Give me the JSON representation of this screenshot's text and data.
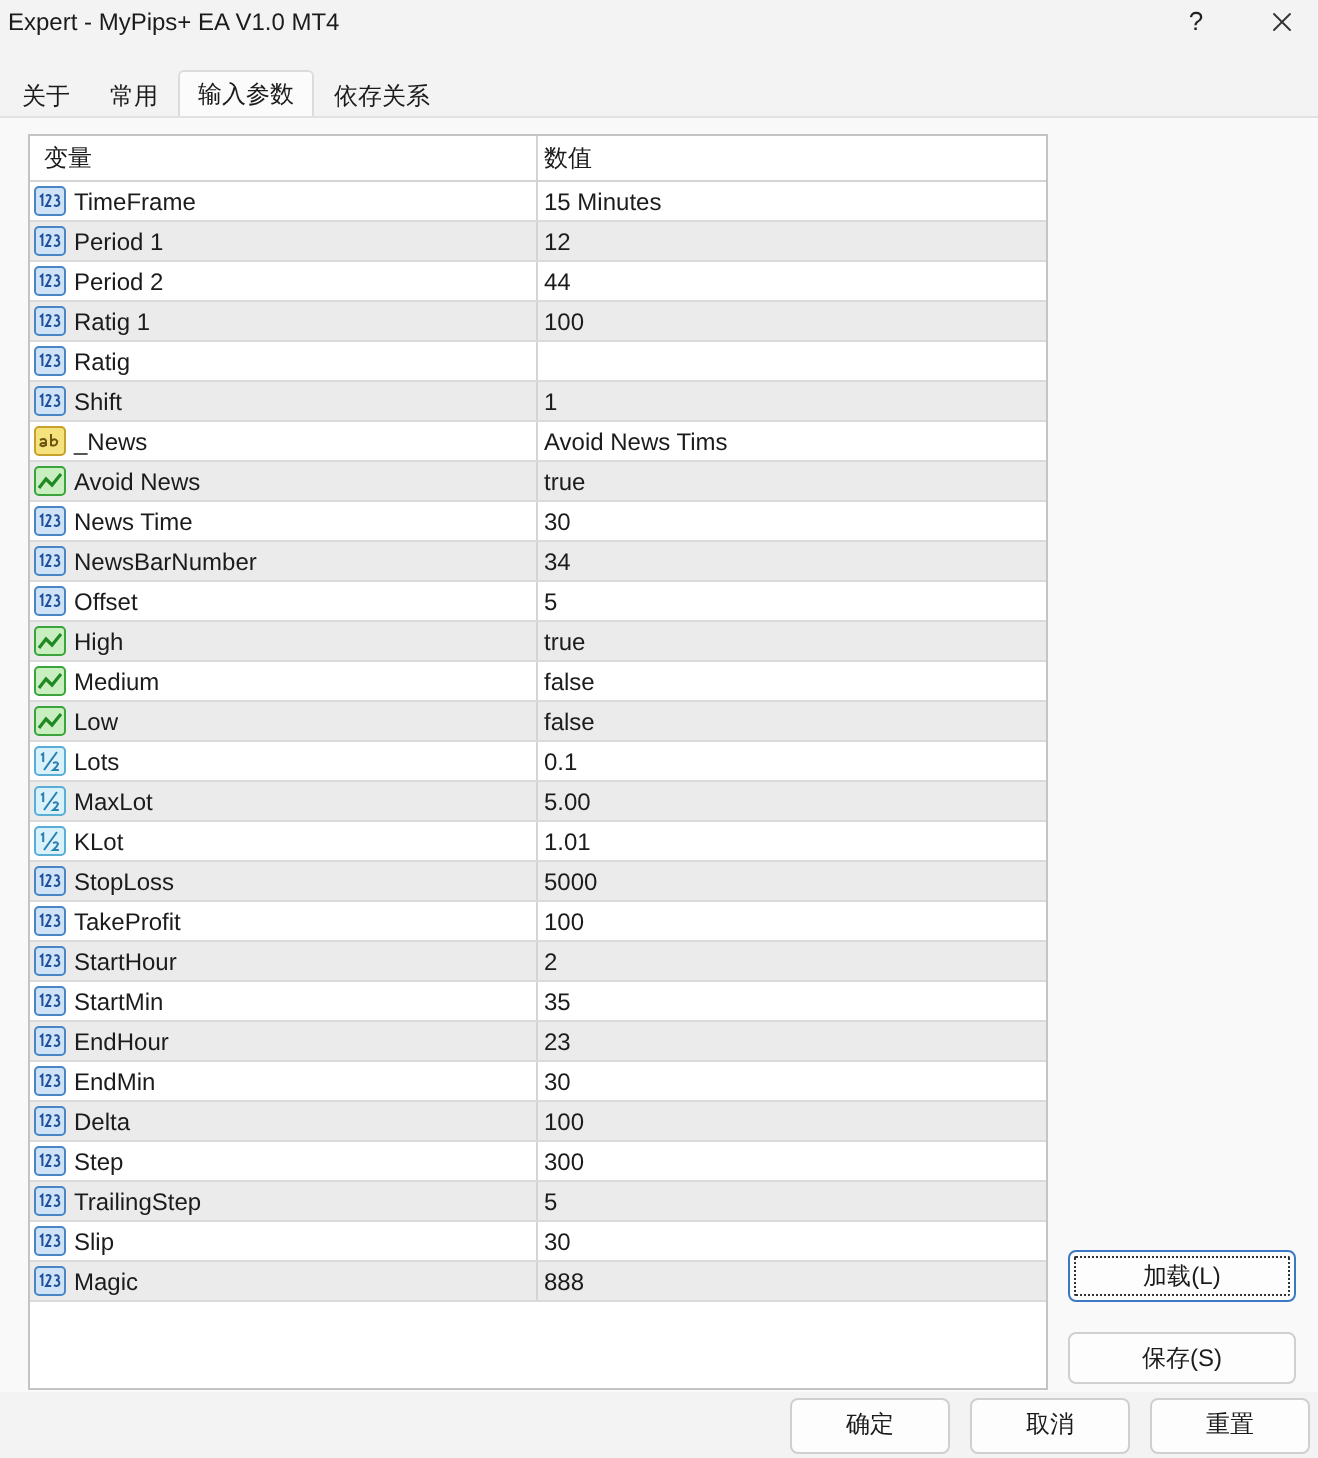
{
  "window": {
    "title": "Expert - MyPips+ EA V1.0 MT4",
    "help_label": "?"
  },
  "tabs": [
    {
      "label": "关于",
      "selected": false
    },
    {
      "label": "常用",
      "selected": false
    },
    {
      "label": "输入参数",
      "selected": true
    },
    {
      "label": "依存关系",
      "selected": false
    }
  ],
  "table": {
    "columns": [
      "变量",
      "数值"
    ],
    "rows": [
      {
        "kind": "int",
        "name": "TimeFrame",
        "value": "15 Minutes"
      },
      {
        "kind": "int",
        "name": "Period 1",
        "value": "12"
      },
      {
        "kind": "int",
        "name": "Period 2",
        "value": "44"
      },
      {
        "kind": "int",
        "name": "Ratig 1",
        "value": "100"
      },
      {
        "kind": "int",
        "name": "Ratig"
      },
      {
        "kind": "int",
        "name": "Shift",
        "value": "1"
      },
      {
        "kind": "string",
        "name": "_News",
        "value": "Avoid News Tims"
      },
      {
        "kind": "bool",
        "name": "Avoid News",
        "value": "true"
      },
      {
        "kind": "int",
        "name": "News Time",
        "value": "30"
      },
      {
        "kind": "int",
        "name": "NewsBarNumber",
        "value": "34"
      },
      {
        "kind": "int",
        "name": "Offset",
        "value": "5"
      },
      {
        "kind": "bool",
        "name": "High",
        "value": "true"
      },
      {
        "kind": "bool",
        "name": "Medium",
        "value": "false"
      },
      {
        "kind": "bool",
        "name": "Low",
        "value": "false"
      },
      {
        "kind": "double",
        "name": "Lots",
        "value": "0.1"
      },
      {
        "kind": "double",
        "name": "MaxLot",
        "value": "5.00"
      },
      {
        "kind": "double",
        "name": "KLot",
        "value": "1.01"
      },
      {
        "kind": "int",
        "name": "StopLoss",
        "value": "5000"
      },
      {
        "kind": "int",
        "name": "TakeProfit",
        "value": "100"
      },
      {
        "kind": "int",
        "name": "StartHour",
        "value": "2"
      },
      {
        "kind": "int",
        "name": "StartMin",
        "value": "35"
      },
      {
        "kind": "int",
        "name": "EndHour",
        "value": "23"
      },
      {
        "kind": "int",
        "name": "EndMin",
        "value": "30"
      },
      {
        "kind": "int",
        "name": "Delta",
        "value": "100"
      },
      {
        "kind": "int",
        "name": "Step",
        "value": "300"
      },
      {
        "kind": "int",
        "name": "TrailingStep",
        "value": "5"
      },
      {
        "kind": "int",
        "name": "Slip",
        "value": "30"
      },
      {
        "kind": "int",
        "name": "Magic",
        "value": "888"
      }
    ]
  },
  "side_buttons": [
    {
      "label": "加载(L)",
      "focused": true
    },
    {
      "label": "保存(S)",
      "focused": false
    }
  ],
  "buttons": [
    {
      "label": "确定",
      "focused": false
    },
    {
      "label": "取消",
      "focused": false
    },
    {
      "label": "重置",
      "focused": false
    }
  ]
}
